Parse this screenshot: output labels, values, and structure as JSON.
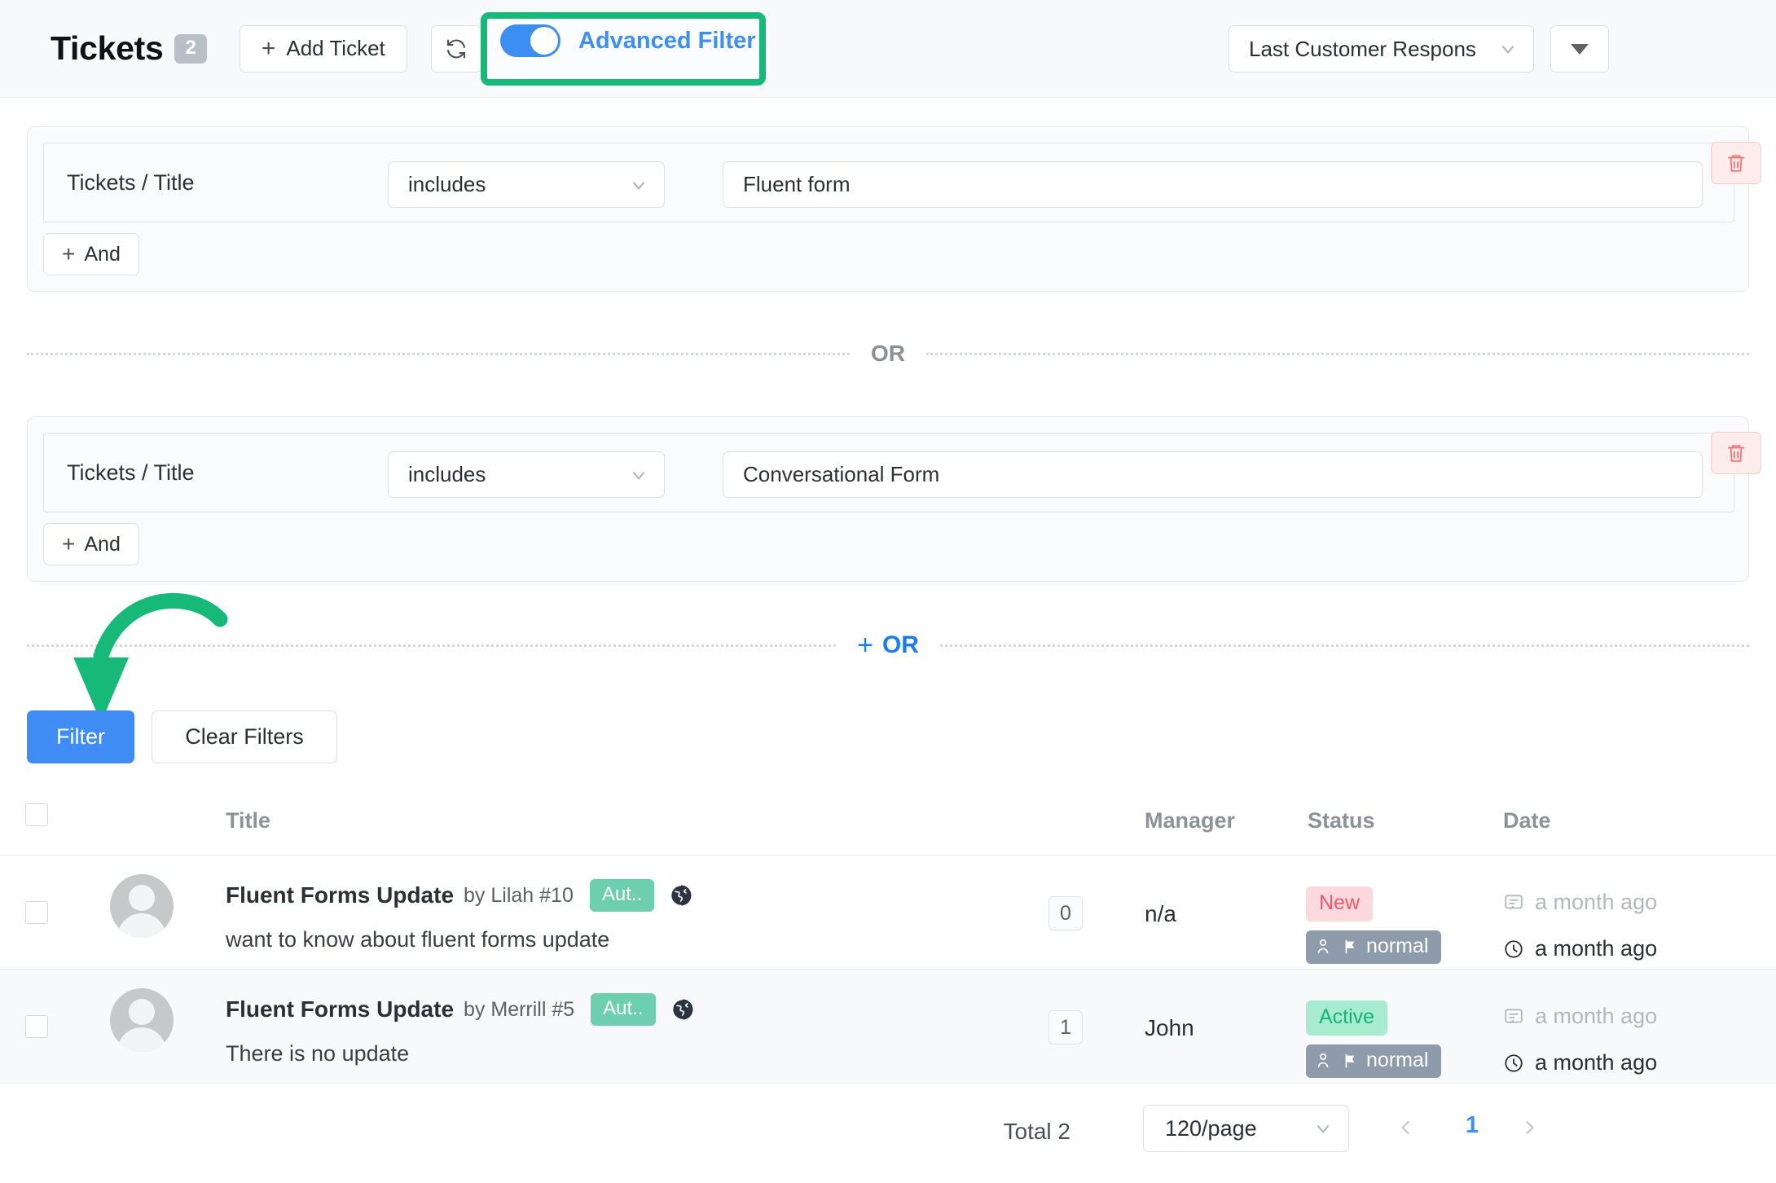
{
  "header": {
    "title": "Tickets",
    "count": "2",
    "add_ticket_label": "Add Ticket",
    "refresh_icon": "refresh-icon",
    "advanced_filter_label": "Advanced Filter",
    "advanced_filter_on": true,
    "sort_value": "Last Customer Respons",
    "sort_order_icon": "caret-down-icon"
  },
  "filter": {
    "groups": [
      {
        "field": "Tickets / Title",
        "operator": "includes",
        "value": "Conversational Form",
        "and_label": "And",
        "delete_icon": "trash-icon"
      }
    ],
    "group1": {
      "field": "Tickets / Title",
      "operator": "includes",
      "value": "Fluent form",
      "and_label": "And",
      "delete_icon": "trash-icon"
    },
    "group2": {
      "field": "Tickets / Title",
      "operator": "includes",
      "value": "Conversational Form",
      "and_label": "And",
      "delete_icon": "trash-icon"
    },
    "or_label": "OR",
    "add_or_label": "OR",
    "add_or_plus": "+",
    "filter_button": "Filter",
    "clear_button": "Clear Filters"
  },
  "table": {
    "columns": {
      "title": "Title",
      "manager": "Manager",
      "status": "Status",
      "date": "Date"
    },
    "rows": [
      {
        "title": "Fluent Forms Update",
        "by": "by Lilah #10",
        "tag": "Aut..",
        "globe_icon": "globe-icon",
        "subtitle": "want to know about fluent forms update",
        "replies": "0",
        "manager": "n/a",
        "status": "New",
        "priority": "normal",
        "date_created": "a month ago",
        "date_updated": "a month ago"
      },
      {
        "title": "Fluent Forms Update",
        "by": "by Merrill #5",
        "tag": "Aut..",
        "globe_icon": "globe-icon",
        "subtitle": "There is no update",
        "replies": "1",
        "manager": "John",
        "status": "Active",
        "priority": "normal",
        "date_created": "a month ago",
        "date_updated": "a month ago"
      }
    ]
  },
  "footer": {
    "total": "Total 2",
    "per_page": "120/page",
    "current_page": "1",
    "prev_icon": "chevron-left-icon",
    "next_icon": "chevron-right-icon"
  },
  "colors": {
    "accent_blue": "#3d8ff5",
    "highlight_green": "#17b978",
    "status_new_bg": "#fcd9dd",
    "status_new_fg": "#f0576e",
    "status_active_bg": "#a7ecd0",
    "status_active_fg": "#18b07b",
    "priority_bg": "#8d9bab",
    "tag_bg": "#6ecfae"
  }
}
